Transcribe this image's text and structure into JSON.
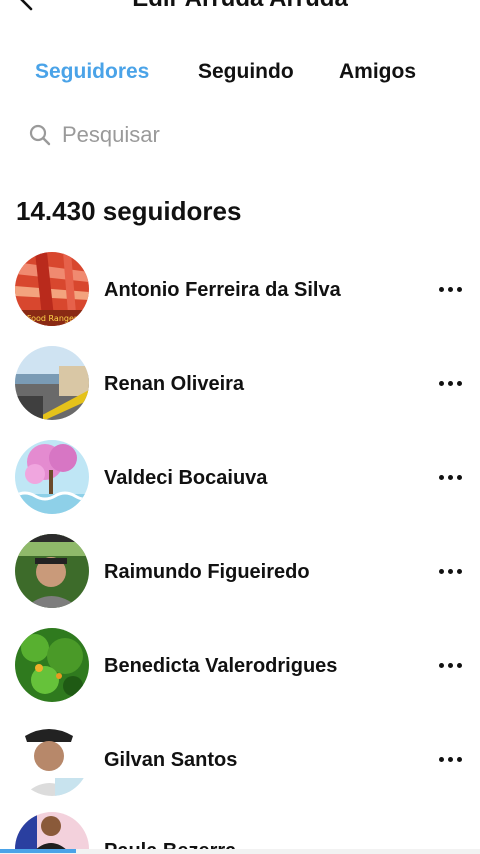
{
  "header": {
    "title": "Edir Arruda Arruda",
    "back_icon": "chevron-left-icon"
  },
  "tabs": [
    {
      "label": "Seguidores",
      "active": true
    },
    {
      "label": "Seguindo",
      "active": false
    },
    {
      "label": "Amigos",
      "active": false
    }
  ],
  "search": {
    "placeholder": "Pesquisar",
    "value": "",
    "icon": "search-icon"
  },
  "followers_count": "14.430 seguidores",
  "followers": [
    {
      "name": "Antonio Ferreira da Silva",
      "avatar_text": "Food Ranger"
    },
    {
      "name": "Renan Oliveira"
    },
    {
      "name": "Valdeci Bocaiuva"
    },
    {
      "name": "Raimundo Figueiredo"
    },
    {
      "name": "Benedicta Valerodrigues"
    },
    {
      "name": "Gilvan Santos"
    },
    {
      "name": "Paula Bezerra"
    }
  ],
  "colors": {
    "accent": "#4aa3e8",
    "text": "#111111",
    "placeholder": "#9a9a9a"
  }
}
